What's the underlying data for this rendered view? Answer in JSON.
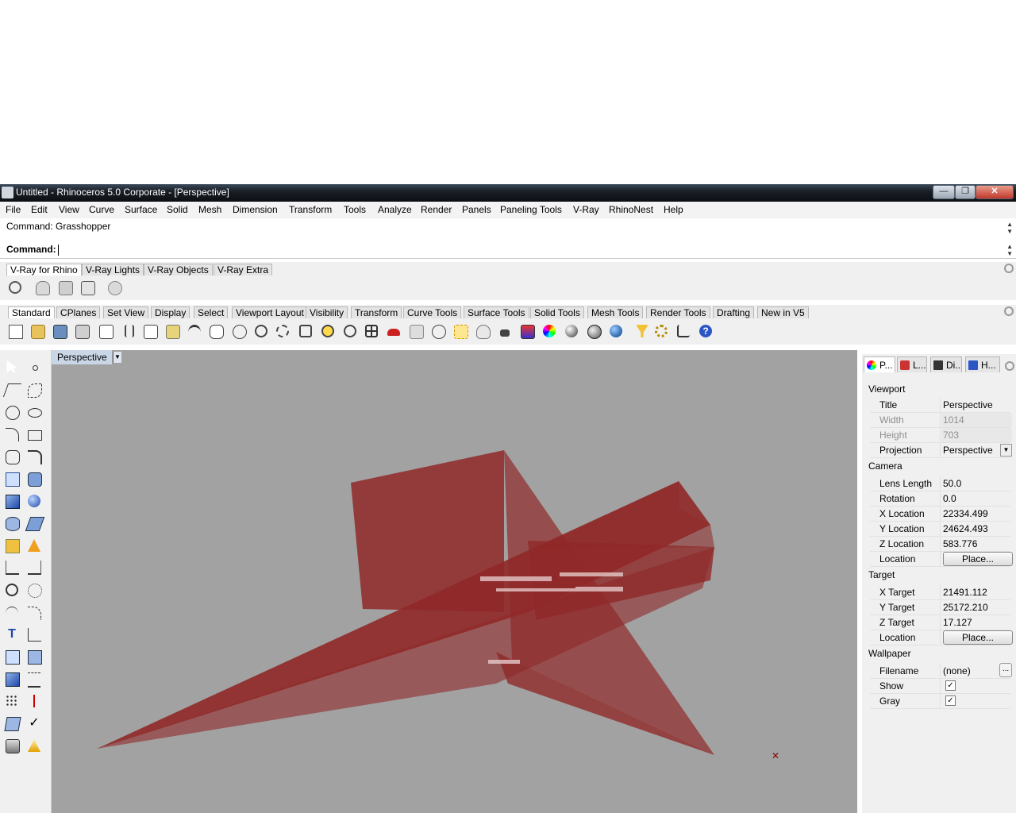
{
  "window": {
    "title": "Untitled - Rhinoceros  5.0 Corporate - [Perspective]",
    "minimize_glyph": "—",
    "restore_glyph": "❐",
    "close_glyph": "✕"
  },
  "menu": [
    "File",
    "Edit",
    "View",
    "Curve",
    "Surface",
    "Solid",
    "Mesh",
    "Dimension",
    "Transform",
    "Tools",
    "Analyze",
    "Render",
    "Panels",
    "Paneling Tools",
    "V-Ray",
    "RhinoNest",
    "Help"
  ],
  "command": {
    "history": "Command: Grasshopper",
    "prompt": "Command:"
  },
  "vray_tabs": [
    "V-Ray for Rhino",
    "V-Ray Lights",
    "V-Ray Objects",
    "V-Ray Extra"
  ],
  "main_tabs": [
    "Standard",
    "CPlanes",
    "Set View",
    "Display",
    "Select",
    "Viewport Layout",
    "Visibility",
    "Transform",
    "Curve Tools",
    "Surface Tools",
    "Solid Tools",
    "Mesh Tools",
    "Render Tools",
    "Drafting",
    "New in V5"
  ],
  "viewport": {
    "label": "Perspective",
    "background": "#a2a2a2",
    "object_color": "#8b0000"
  },
  "panel_tabs": [
    "P...",
    "L...",
    "Di...",
    "H..."
  ],
  "properties": {
    "viewport_section": "Viewport",
    "title_label": "Title",
    "title_value": "Perspective",
    "width_label": "Width",
    "width_value": "1014",
    "height_label": "Height",
    "height_value": "703",
    "projection_label": "Projection",
    "projection_value": "Perspective",
    "camera_section": "Camera",
    "lens_label": "Lens Length",
    "lens_value": "50.0",
    "rotation_label": "Rotation",
    "rotation_value": "0.0",
    "xloc_label": "X Location",
    "xloc_value": "22334.499",
    "yloc_label": "Y Location",
    "yloc_value": "24624.493",
    "zloc_label": "Z Location",
    "zloc_value": "583.776",
    "cam_location_label": "Location",
    "place_button": "Place...",
    "target_section": "Target",
    "xt_label": "X Target",
    "xt_value": "21491.112",
    "yt_label": "Y Target",
    "yt_value": "25172.210",
    "zt_label": "Z Target",
    "zt_value": "17.127",
    "tgt_location_label": "Location",
    "wallpaper_section": "Wallpaper",
    "filename_label": "Filename",
    "filename_value": "(none)",
    "show_label": "Show",
    "gray_label": "Gray",
    "check_glyph": "✓",
    "ellipsis": "..."
  }
}
